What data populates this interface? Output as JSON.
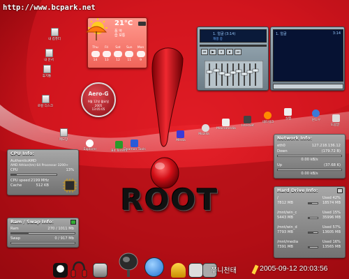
{
  "watermark": "http://www.bcpark.net",
  "weather": {
    "temperature": "21°C",
    "line1": "풍 약",
    "line2": "습 보통",
    "days": [
      "Thu",
      "Fri",
      "Sat",
      "Sun",
      "Mon"
    ],
    "temps": [
      "14",
      "13",
      "12",
      "11",
      "9"
    ]
  },
  "clock": {
    "brand": "Aero-G",
    "date_kr": "9월 12일 월요일",
    "year": "2005",
    "time": "13:05:05"
  },
  "media_player": {
    "track": "1. 얼굴 (3:14)",
    "status": "재생 중",
    "playlist_item": "1. 얼굴",
    "playlist_time": "3:14"
  },
  "desktop_icons": [
    {
      "label": "내 컴퓨터",
      "icon": "computer-icon"
    },
    {
      "label": "내 문서",
      "icon": "folder-icon"
    },
    {
      "label": "휴지통",
      "icon": "trash-icon"
    },
    {
      "label": "로컬 디스크",
      "icon": "disk-icon"
    },
    {
      "label": "메모장",
      "icon": "notepad-icon"
    }
  ],
  "row_icons": [
    "Explorer",
    "Bit Torrent",
    "Deamon Tools",
    "Media",
    "Mozilla",
    "Macromedia",
    "Internet",
    "네트워크",
    "실행",
    "윈도우",
    "도움말"
  ],
  "cpu": {
    "title": "CPU Info:",
    "vendor": "AuthenticAMD",
    "model": "AMD Athlon(tm) 64 Processor 3200+",
    "usage_label": "CPU",
    "usage_value": "13%",
    "usage_pct": 13,
    "speed_label": "CPU speed",
    "speed_value": "2199 MHz",
    "cache_label": "Cache",
    "cache_value": "512 KB"
  },
  "ram": {
    "title": "Ram / Swap Info:",
    "ram_label": "Ram",
    "ram_value": "270 / 1011 Mb",
    "ram_pct": 27,
    "swap_label": "Swap",
    "swap_value": "0 / 917 Mb",
    "swap_pct": 0
  },
  "network": {
    "title": "Network Info:",
    "iface": "eth0",
    "ip": "127.218.136.12",
    "down_label": "Down",
    "down_total": "(179.72 B)",
    "down_rate": "0.00 kB/s",
    "up_label": "Up",
    "up_total": "(37.68 K)",
    "up_rate": "0.00 kB/s"
  },
  "drives": {
    "title": "Hard Drive Info:",
    "items": [
      {
        "name": "/",
        "used": "Used 42%",
        "pct": 42,
        "free": "7812 MB",
        "total": "18574 MB"
      },
      {
        "name": "/mnt/win_c",
        "used": "Used 15%",
        "pct": 15,
        "free": "5443 MB",
        "total": "35996 MB"
      },
      {
        "name": "/mnt/win_d",
        "used": "Used 57%",
        "pct": 57,
        "free": "7793 MB",
        "total": "13605 MB"
      },
      {
        "name": "/mnt/media",
        "used": "Used 16%",
        "pct": 16,
        "free": "7391 MB",
        "total": "13565 MB"
      }
    ]
  },
  "logo_text": "ROOT",
  "taskbar": {
    "datetime": "2005-09-12 20:03:56",
    "label": "쭈니천태"
  },
  "colors": {
    "background": "#c4121a",
    "panel": "#8d8d8d",
    "player": "#8e9ea8"
  }
}
